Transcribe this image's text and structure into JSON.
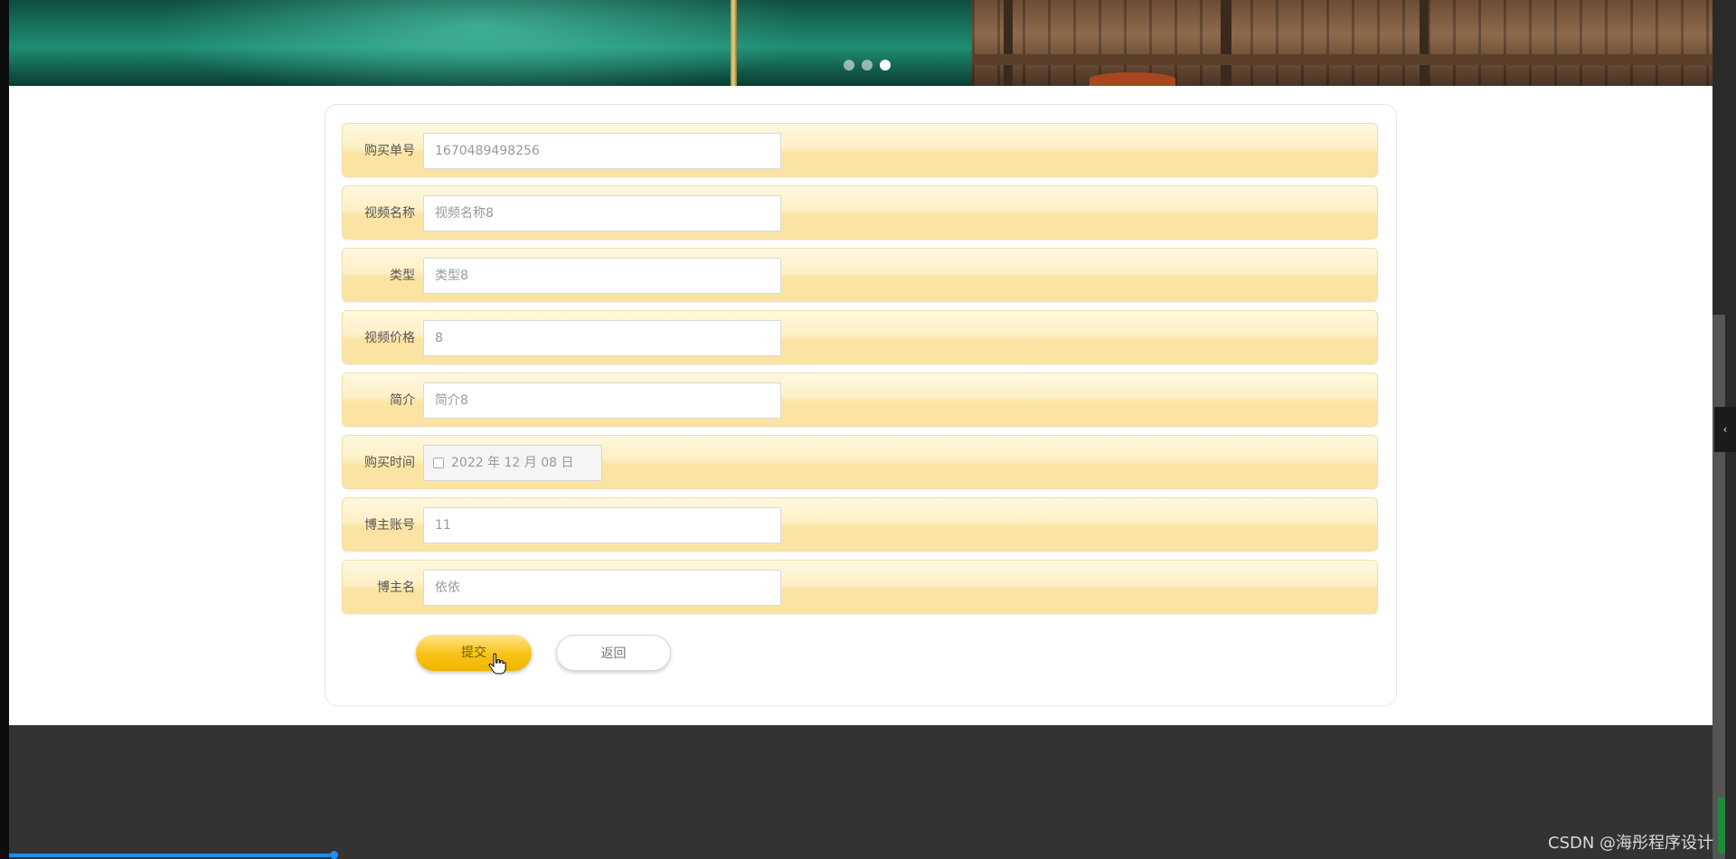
{
  "banner": {
    "slide_count": 3,
    "active_slide": 3
  },
  "form": {
    "fields": [
      {
        "label": "购买单号",
        "value": "1670489498256"
      },
      {
        "label": "视频名称",
        "value": "视频名称8"
      },
      {
        "label": "类型",
        "value": "类型8"
      },
      {
        "label": "视频价格",
        "value": "8"
      },
      {
        "label": "简介",
        "value": "简介8"
      },
      {
        "label": "购买时间",
        "value": "2022 年 12 月 08 日"
      },
      {
        "label": "博主账号",
        "value": "11"
      },
      {
        "label": "博主名",
        "value": "依依"
      }
    ],
    "submit_label": "提交",
    "back_label": "返回"
  },
  "side_tab_icon": "chevron-left-icon",
  "watermark": "CSDN @海彤程序设计",
  "colors": {
    "submit_button": "#f8c316",
    "row_band": "#fbe3a3",
    "footer": "#333333"
  }
}
